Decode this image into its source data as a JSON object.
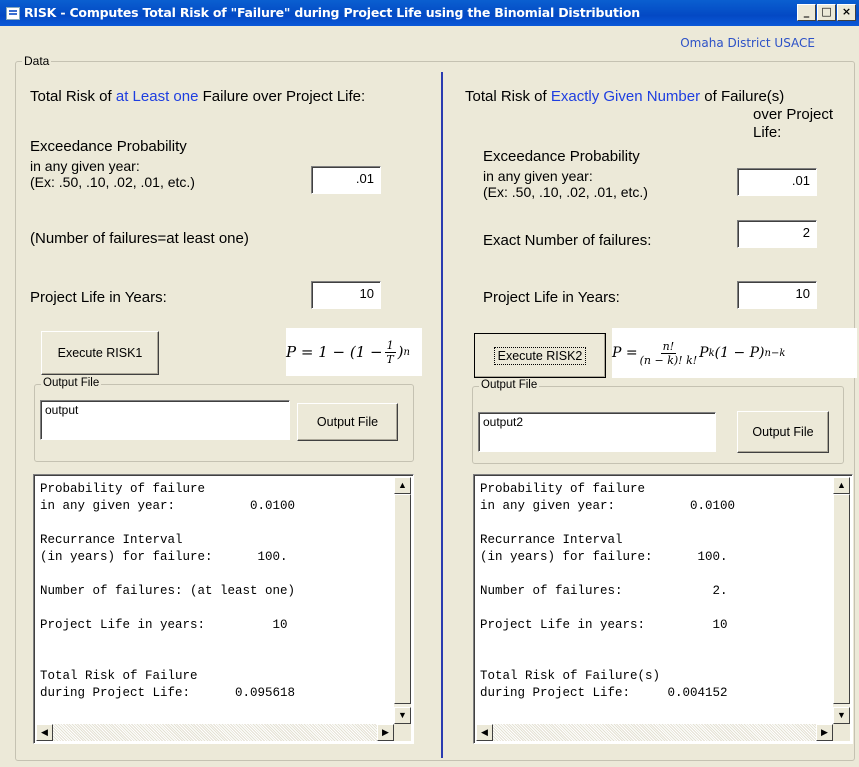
{
  "window": {
    "title": "RISK - Computes Total Risk of  \"Failure\"  during Project Life using the Binomial Distribution",
    "org_label": "Omaha District USACE",
    "minimize_glyph": "_",
    "maximize_glyph": "□",
    "close_glyph": "×"
  },
  "data_group": {
    "legend": "Data"
  },
  "left": {
    "heading_prefix": "Total Risk of",
    "heading_highlight": "at Least one",
    "heading_suffix": "Failure over Project Life:",
    "exceedance_line1": "Exceedance Probability",
    "exceedance_line2": "in any given year:",
    "exceedance_line3": "(Ex: .50, .10, .02, .01, etc.)",
    "exceedance_value": ".01",
    "failures_note": "(Number of failures=at least one)",
    "project_life_label": "Project Life in Years:",
    "project_life_value": "10",
    "execute_label": "Execute RISK1",
    "output_legend": "Output File",
    "output_value": "output",
    "output_button": "Output File",
    "results": "Probability of failure\nin any given year:          0.0100\n\nRecurrance Interval\n(in years) for failure:      100.\n\nNumber of failures: (at least one)\n\nProject Life in years:         10\n\n\nTotal Risk of Failure\nduring Project Life:      0.095618"
  },
  "right": {
    "heading_prefix": "Total Risk of",
    "heading_highlight": "Exactly Given Number",
    "heading_suffix_1": "of Failure(s)",
    "heading_suffix_2": "over Project",
    "heading_suffix_3": "Life:",
    "exceedance_line1": "Exceedance Probability",
    "exceedance_line2": "in any given year:",
    "exceedance_line3": "(Ex: .50, .10, .02, .01, etc.)",
    "exceedance_value": ".01",
    "exact_failures_label": "Exact Number of failures:",
    "exact_failures_value": "2",
    "project_life_label": "Project Life in Years:",
    "project_life_value": "10",
    "execute_label": "Execute RISK2",
    "output_legend": "Output File",
    "output_value": "output2",
    "output_button": "Output File",
    "results": "Probability of failure\nin any given year:          0.0100\n\nRecurrance Interval\n(in years) for failure:      100.\n\nNumber of failures:            2.\n\nProject Life in years:         10\n\n\nTotal Risk of Failure(s)\nduring Project Life:     0.004152"
  },
  "formula1": {
    "lhs": "P = 1 − (1 − ",
    "num": "1",
    "den": "T",
    "rhs": ")",
    "exp": "n"
  },
  "formula2": {
    "lhs": "P = ",
    "num": "n!",
    "den": "(n − k)! k!",
    "mid": " P",
    "exp_k": "k",
    "rhs": "(1 − P)",
    "exp_nk": "n−k"
  },
  "icons": {
    "app": "app-window-icon",
    "scroll_up": "▲",
    "scroll_down": "▼",
    "scroll_left": "◀",
    "scroll_right": "▶"
  }
}
